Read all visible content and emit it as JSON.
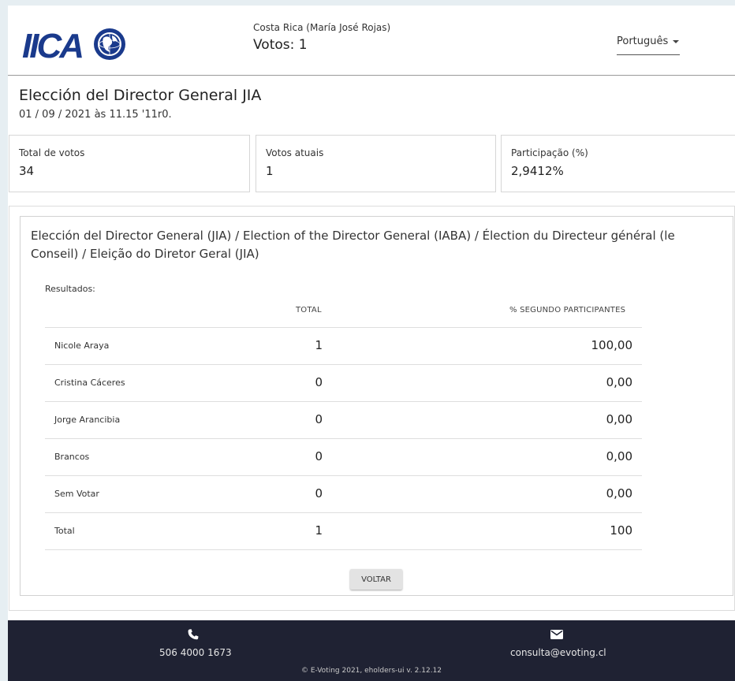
{
  "header": {
    "logo_text": "IICA",
    "voter": "Costa Rica (María José Rojas)",
    "votes": "Votos: 1",
    "language": "Português"
  },
  "election": {
    "title": "Elección del Director General JIA",
    "date": "01 / 09 / 2021 às 11.15 '11r0."
  },
  "stats": [
    {
      "label": "Total de votos",
      "value": "34"
    },
    {
      "label": "Votos atuais",
      "value": "1"
    },
    {
      "label": "Participação (%)",
      "value": "2,9412%"
    }
  ],
  "results": {
    "question": "Elección del Director General (JIA) / Election of the Director General (IABA) / Élection du Directeur général (le Conseil) / Eleição do Diretor Geral (JIA)",
    "label": "Resultados:",
    "col_total": "TOTAL",
    "col_pct": "% SEGUNDO PARTICIPANTES",
    "rows": [
      {
        "name": "Nicole Araya",
        "total": "1",
        "pct": "100,00"
      },
      {
        "name": "Cristina Cáceres",
        "total": "0",
        "pct": "0,00"
      },
      {
        "name": "Jorge Arancibia",
        "total": "0",
        "pct": "0,00"
      },
      {
        "name": "Brancos",
        "total": "0",
        "pct": "0,00"
      },
      {
        "name": "Sem Votar",
        "total": "0",
        "pct": "0,00"
      },
      {
        "name": "Total",
        "total": "1",
        "pct": "100"
      }
    ],
    "back_label": "VOLTAR"
  },
  "footer": {
    "phone": "506 4000 1673",
    "email": "consulta@evoting.cl",
    "copyright": "© E-Voting 2021, eholders-ui v. 2.12.12",
    "phone_icon": "phone-icon",
    "mail_icon": "mail-icon"
  },
  "colors": {
    "brand_blue": "#1a3a8c",
    "footer_bg": "#1f2233",
    "page_bg": "#e6eef2"
  }
}
